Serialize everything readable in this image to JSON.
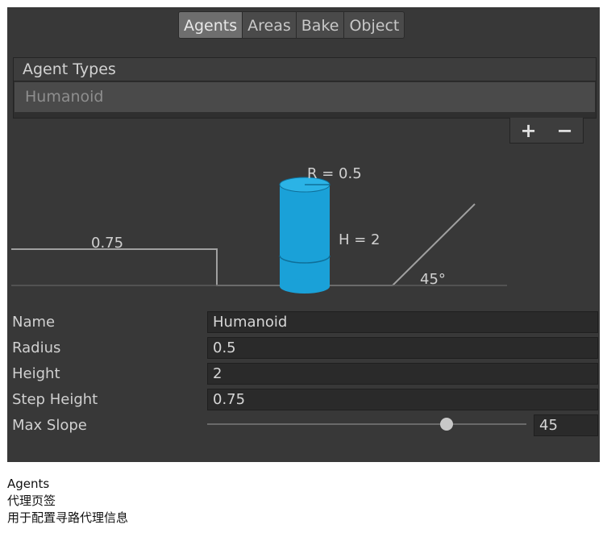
{
  "tabs": [
    {
      "label": "Agents",
      "active": true
    },
    {
      "label": "Areas",
      "active": false
    },
    {
      "label": "Bake",
      "active": false
    },
    {
      "label": "Object",
      "active": false
    }
  ],
  "agent_types": {
    "header": "Agent Types",
    "items": [
      "Humanoid"
    ],
    "add_label": "+",
    "remove_label": "−"
  },
  "diagram": {
    "radius_label": "R = 0.5",
    "height_label": "H = 2",
    "step_label": "0.75",
    "slope_label": "45°",
    "cylinder_color": "#1aa1d8"
  },
  "properties": {
    "name": {
      "label": "Name",
      "value": "Humanoid"
    },
    "radius": {
      "label": "Radius",
      "value": "0.5"
    },
    "height": {
      "label": "Height",
      "value": "2"
    },
    "step_height": {
      "label": "Step Height",
      "value": "0.75"
    },
    "max_slope": {
      "label": "Max Slope",
      "value": "45",
      "fraction": 0.75
    }
  },
  "caption": {
    "line1": "Agents",
    "line2": "代理页签",
    "line3": "用于配置寻路代理信息"
  }
}
